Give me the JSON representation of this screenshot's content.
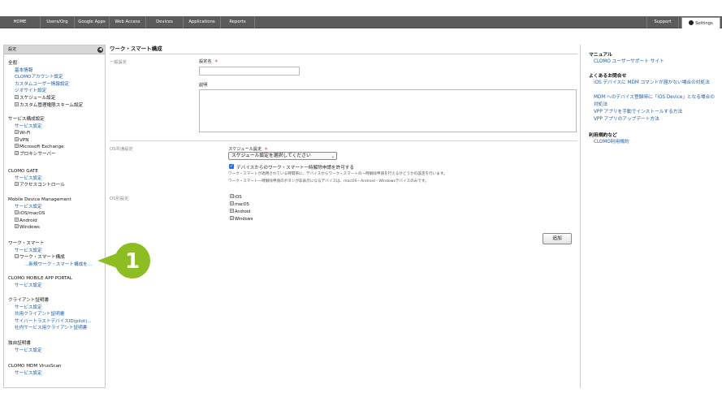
{
  "topnav": {
    "items": [
      "HOME",
      "Users/Org",
      "Google Apps",
      "Web Access",
      "Devices",
      "Applications",
      "Reports"
    ],
    "support": "Support",
    "settings": "Settings"
  },
  "sidebar": {
    "header": "設定",
    "general": {
      "title": "全般",
      "links": [
        "基本情報",
        "CLOMOアカウント設定",
        "カスタムユーザー情報設定",
        "ジオサイト設定"
      ],
      "trees": [
        "スケジュール設定",
        "カスタム管理権限スキーム設定"
      ]
    },
    "service": {
      "title": "サービス構成設定",
      "links": [
        "サービス設定"
      ],
      "trees": [
        "Wi-Fi",
        "VPN",
        "Microsoft Exchange",
        "プロキシサーバー"
      ]
    },
    "gate": {
      "title": "CLOMO GATE",
      "links": [
        "サービス設定"
      ],
      "trees": [
        "アクセスコントロール"
      ]
    },
    "mdm": {
      "title": "Mobile Device Management",
      "links": [
        "サービス設定"
      ],
      "trees": [
        "iOS/macOS",
        "Android",
        "Windows"
      ]
    },
    "worksmart": {
      "title": "ワーク・スマート",
      "links": [
        "サービス設定"
      ],
      "trees": [
        "ワーク・スマート構成"
      ],
      "sub": "...新規ワーク・スマート構成を..."
    },
    "portal": {
      "title": "CLOMO MOBILE APP PORTAL",
      "links": [
        "サービス設定"
      ]
    },
    "client_cert": {
      "title": "クライアント証明書",
      "links": [
        "サービス設定",
        "共用クライアント証明書",
        "サイバートラストデバイスID(pilot)...",
        "社内サービス用クライアント証明書"
      ]
    },
    "own_cert": {
      "title": "独自証明書",
      "links": [
        "サービス設定"
      ]
    },
    "virusscan": {
      "title": "CLOMO MDM VirusScan",
      "links": [
        "サービス設定"
      ]
    }
  },
  "callout": {
    "number": "1",
    "color": "#8dbd22"
  },
  "main": {
    "title": "ワーク・スマート構成",
    "general_section": "一般設定",
    "name_label": "設定名",
    "required_mark": "＊",
    "description_label": "説明",
    "os_common_section": "OS共通設定",
    "schedule_label": "スケジュール設定",
    "schedule_value": "スケジュール設定を選択してください",
    "allow_label": "デバイスからのワーク・スマート一時解除申請を許可する",
    "allow_checked": true,
    "note1": "ワーク・スマートが適用されている時間帯に、デバイスからワーク・スマートの一時解除申請を行えるかどうかの設定を行います。",
    "note2": "ワーク・スマート一時解除申請のボタンが非表示になるデバイスは、macOS・Android・Windowsデバイスのみです。",
    "os_section": "OS別設定",
    "os_items": [
      "iOS",
      "macOS",
      "Android",
      "Windows"
    ],
    "add_button": "追加"
  },
  "right": {
    "manual_title": "マニュアル",
    "manual_links": [
      "CLOMO ユーザーサポート サイト"
    ],
    "faq_title": "よくあるお問合せ",
    "faq_links": [
      "iOS デバイスに MDM コマンドが届かない場合の対処法",
      "MDM へのデバイス登録時に「iOS Device」となる場合の対処法",
      "VPP アプリを手動でインストールする方法",
      "VPP アプリのアップデート方法"
    ],
    "terms_title": "利用規約など",
    "terms_links": [
      "CLOMO利用規約"
    ]
  },
  "colors": {
    "nav_bg": "#5b5b5b",
    "link": "#1c5aa6",
    "required": "#dd3333",
    "callout": "#8dbd22"
  }
}
